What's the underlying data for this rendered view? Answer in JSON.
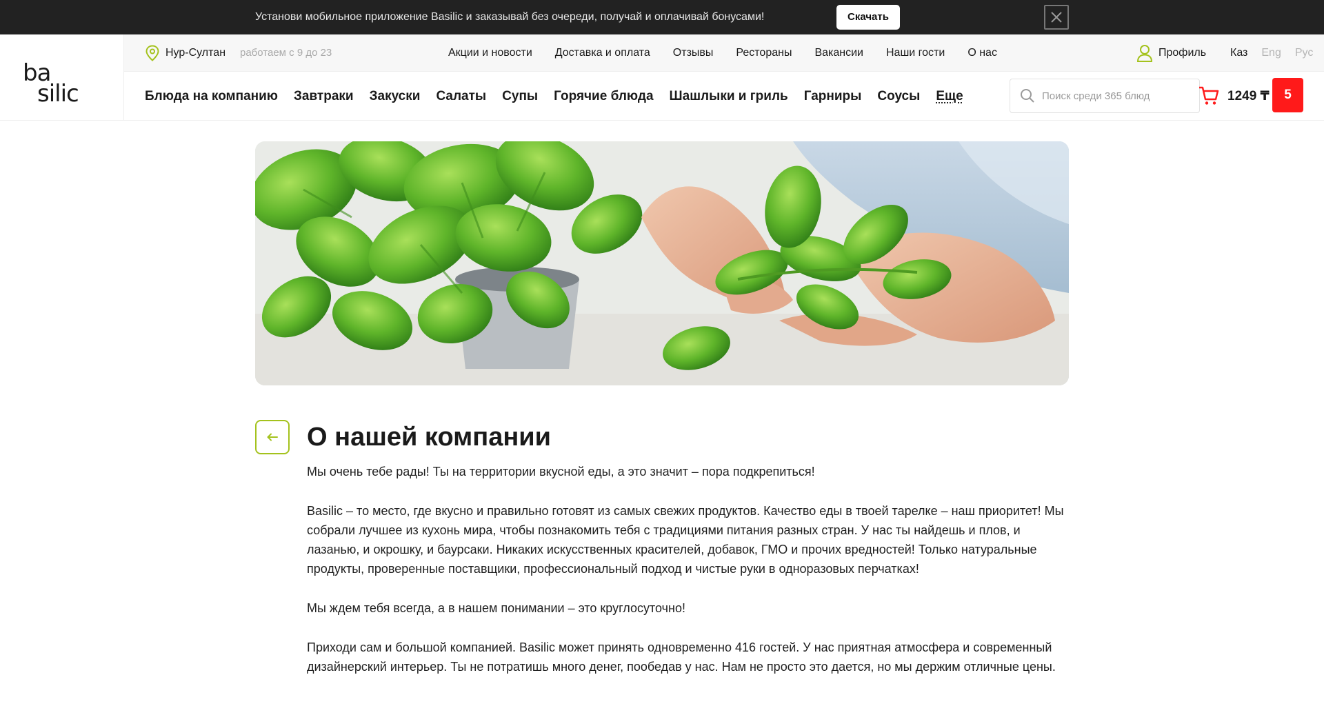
{
  "promo": {
    "text": "Установи мобильное приложение Basilic и заказывай без очереди, получай и оплачивай бонусами!",
    "button_label": "Скачать"
  },
  "logo": {
    "line1": "ba",
    "line2": "silic"
  },
  "topbar": {
    "city": "Нур-Султан",
    "hours": "работаем с 9 до 23",
    "nav": [
      "Акции и новости",
      "Доставка и оплата",
      "Отзывы",
      "Рестораны",
      "Вакансии",
      "Наши гости",
      "О нас"
    ],
    "profile_label": "Профиль",
    "languages": [
      "Каз",
      "Eng",
      "Рус"
    ]
  },
  "catnav": {
    "items": [
      "Блюда на компанию",
      "Завтраки",
      "Закуски",
      "Салаты",
      "Супы",
      "Горячие блюда",
      "Шашлыки и гриль",
      "Гарниры",
      "Соусы"
    ],
    "more_label": "Еще"
  },
  "search": {
    "placeholder": "Поиск среди 365 блюд"
  },
  "cart": {
    "sum": "1249 ₸",
    "count": "5"
  },
  "colors": {
    "accent_green": "#a4c21d",
    "cart_red": "#ff1a1a",
    "promo_bg": "#222222"
  },
  "page": {
    "title": "О нашей компании",
    "paragraphs": [
      "Мы очень тебе рады! Ты на территории вкусной еды, а это значит – пора подкрепиться!",
      "Basilic – то место, где вкусно и правильно готовят из самых свежих продуктов. Качество еды в твоей тарелке – наш приоритет! Мы собрали лучшее из кухонь мира, чтобы познакомить тебя с традициями питания разных стран. У нас ты найдешь и плов, и лазанью, и окрошку, и баурсаки. Никаких искусственных красителей, добавок, ГМО и прочих вредностей! Только натуральные продукты, проверенные поставщики, профессиональный подход и чистые руки в одноразовых перчатках!",
      "Мы ждем тебя всегда, а в нашем понимании – это круглосуточно!",
      "Приходи сам и большой компанией. Basilic может принять одновременно 416 гостей. У нас приятная атмосфера и современный дизайнерский интерьер. Ты не потратишь много денег, пообедав у нас. Нам не просто это дается, но мы держим отличные цены."
    ]
  }
}
